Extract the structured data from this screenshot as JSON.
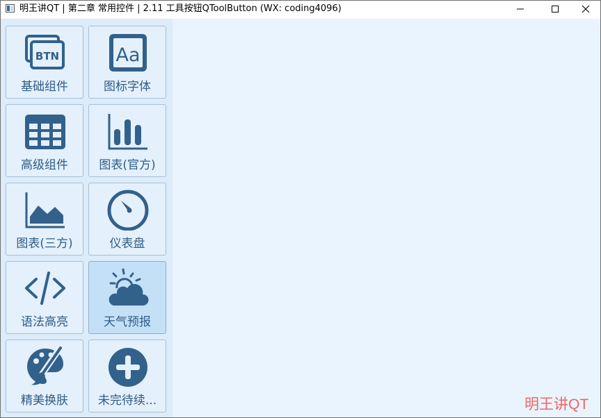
{
  "window": {
    "title": "明王讲QT | 第二章 常用控件 | 2.11 工具按钮QToolButton (WX: coding4096)"
  },
  "toolbar": {
    "buttons": [
      {
        "label": "基础组件",
        "icon": "btn-icon"
      },
      {
        "label": "图标字体",
        "icon": "font-icon"
      },
      {
        "label": "高级组件",
        "icon": "table-icon"
      },
      {
        "label": "图表(官方)",
        "icon": "bar-chart-icon"
      },
      {
        "label": "图表(三方)",
        "icon": "area-chart-icon"
      },
      {
        "label": "仪表盘",
        "icon": "gauge-icon"
      },
      {
        "label": "语法高亮",
        "icon": "code-icon"
      },
      {
        "label": "天气预报",
        "icon": "weather-icon",
        "active": true
      },
      {
        "label": "精美换肤",
        "icon": "palette-icon"
      },
      {
        "label": "未完待续...",
        "icon": "plus-icon"
      }
    ]
  },
  "watermark": "明王讲QT",
  "colors": {
    "icon": "#32618b",
    "label": "#2f5c86",
    "sidebar_bg": "#dcecfb",
    "main_bg": "#eaf4fe",
    "active_bg": "#c4e0f7",
    "watermark": "#f26464"
  }
}
